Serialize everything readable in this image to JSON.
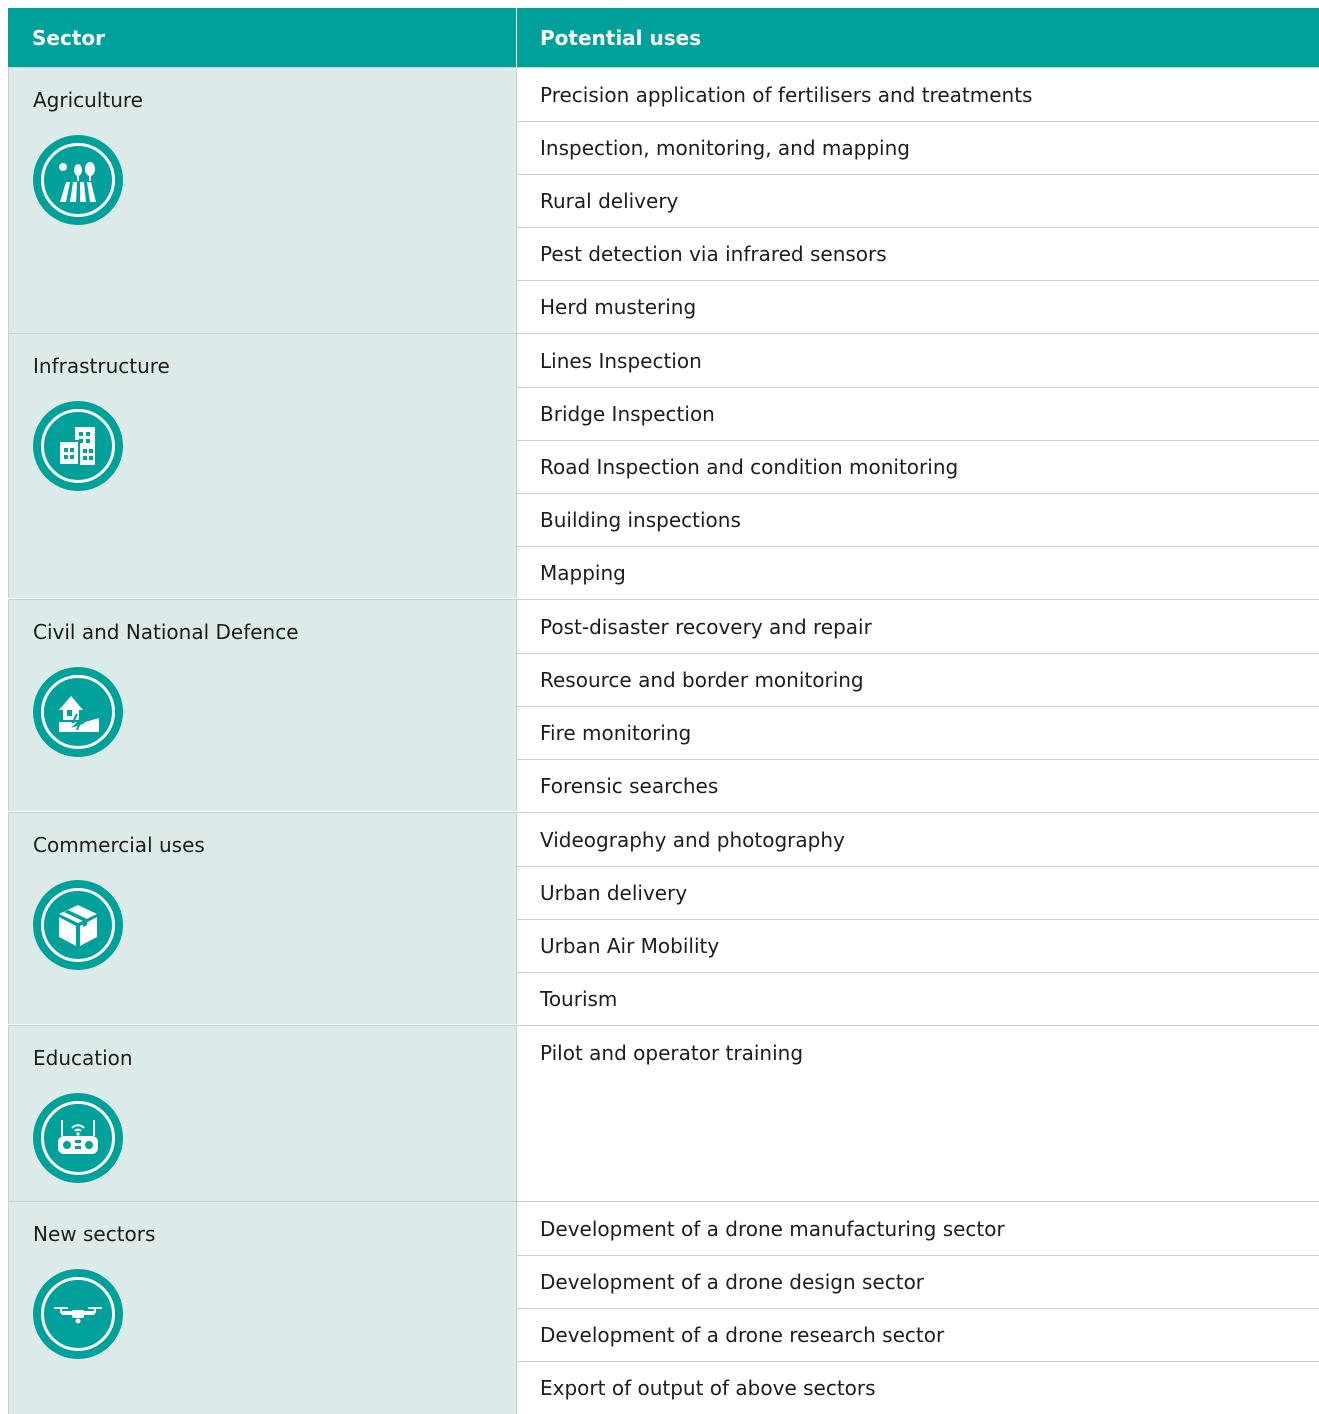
{
  "header": {
    "sector": "Sector",
    "uses": "Potential uses"
  },
  "colors": {
    "accent": "#00a19a",
    "sector_bg": "#dcebea"
  },
  "groups": [
    {
      "sector": "Agriculture",
      "icon": "agriculture-field-icon",
      "uses": [
        "Precision application of fertilisers and treatments",
        "Inspection, monitoring, and mapping",
        "Rural delivery",
        "Pest detection via infrared sensors",
        "Herd mustering"
      ]
    },
    {
      "sector": "Infrastructure",
      "icon": "buildings-icon",
      "uses": [
        "Lines Inspection",
        "Bridge Inspection",
        "Road Inspection and condition monitoring",
        "Building inspections",
        "Mapping"
      ]
    },
    {
      "sector": "Civil and National Defence",
      "icon": "disaster-house-icon",
      "uses": [
        "Post-disaster recovery and repair",
        "Resource and border monitoring",
        "Fire monitoring",
        "Forensic searches"
      ]
    },
    {
      "sector": "Commercial uses",
      "icon": "package-box-icon",
      "uses": [
        "Videography and photography",
        "Urban delivery",
        "Urban Air Mobility",
        "Tourism"
      ]
    },
    {
      "sector": "Education",
      "icon": "drone-controller-icon",
      "uses": [
        "Pilot and operator training"
      ]
    },
    {
      "sector": "New sectors",
      "icon": "drone-icon",
      "uses": [
        "Development of a drone manufacturing sector",
        "Development of a drone design sector",
        "Development of a drone research sector",
        "Export of output of above sectors"
      ]
    }
  ]
}
